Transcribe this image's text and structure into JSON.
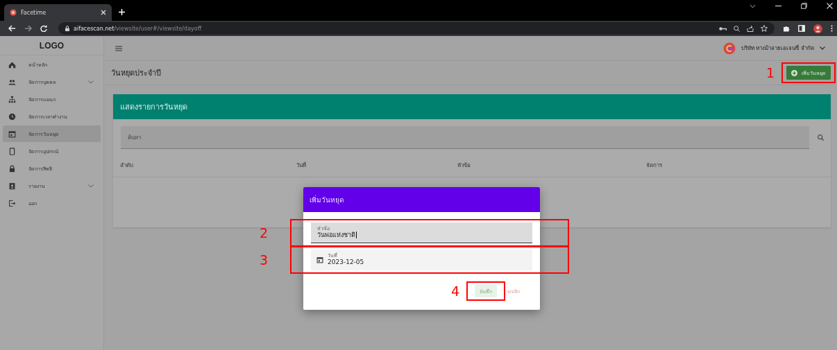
{
  "browser": {
    "tab_title": "Facetime",
    "url_host": "aifacescan.net",
    "url_path": "/viewsite/user#/viewsite/dayoff"
  },
  "sidebar": {
    "logo": "LOGO",
    "items": [
      {
        "label": "หน้าหลัก",
        "selected": false,
        "expandable": false
      },
      {
        "label": "จัดการบุคคล",
        "selected": false,
        "expandable": true
      },
      {
        "label": "จัดการแผนก",
        "selected": false,
        "expandable": false
      },
      {
        "label": "จัดการเวลาทำงาน",
        "selected": false,
        "expandable": false
      },
      {
        "label": "จัดการวันหยุด",
        "selected": true,
        "expandable": false
      },
      {
        "label": "จัดการอุปกรณ์",
        "selected": false,
        "expandable": false
      },
      {
        "label": "จัดการสิทธิ",
        "selected": false,
        "expandable": false
      },
      {
        "label": "รายงาน",
        "selected": false,
        "expandable": true
      },
      {
        "label": "ออก",
        "selected": false,
        "expandable": false
      }
    ]
  },
  "header": {
    "company": "บริษัท หางม้าลายเอเจนซี่ จำกัด"
  },
  "page_title": "วันหยุดประจำปี",
  "add_button": "เพิ่มวันหยุด",
  "card": {
    "title": "แสดงรายการวันหยุด",
    "search_placeholder": "ค้นหา",
    "columns": [
      "ลำดับ",
      "วันที่",
      "หัวข้อ",
      "จัดการ"
    ]
  },
  "dialog": {
    "title": "เพิ่มวันหยุด",
    "fields": [
      {
        "kind": "text",
        "label": "หัวข้อ",
        "value": "วันพ่อแห่งชาติ",
        "focused": true
      },
      {
        "kind": "date",
        "label": "วันที่",
        "value": "2023-12-05",
        "focused": false
      }
    ],
    "buttons": [
      {
        "label": "บันทึก",
        "kind": "save"
      },
      {
        "label": "ยกเลิก",
        "kind": "cancel"
      }
    ]
  },
  "annotations": [
    {
      "number": "1"
    },
    {
      "number": "2"
    },
    {
      "number": "3"
    },
    {
      "number": "4"
    }
  ]
}
